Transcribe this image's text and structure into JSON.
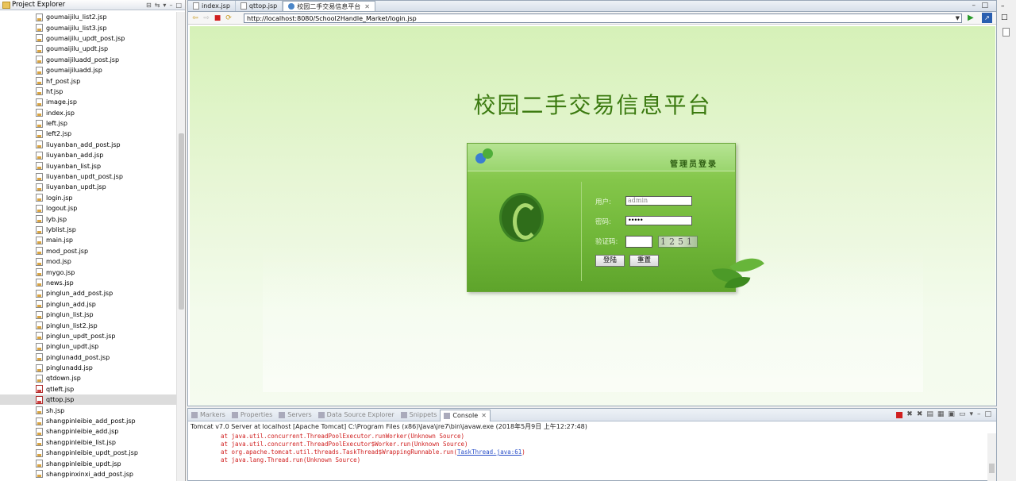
{
  "project_explorer": {
    "title": "Project Explorer",
    "files": [
      {
        "name": "goumaijilu_list2.jsp",
        "type": "jsp"
      },
      {
        "name": "goumaijilu_list3.jsp",
        "type": "jsp"
      },
      {
        "name": "goumaijilu_updt_post.jsp",
        "type": "jsp"
      },
      {
        "name": "goumaijilu_updt.jsp",
        "type": "jsp"
      },
      {
        "name": "goumaijiluadd_post.jsp",
        "type": "jsp"
      },
      {
        "name": "goumaijiluadd.jsp",
        "type": "jsp"
      },
      {
        "name": "hf_post.jsp",
        "type": "jsp"
      },
      {
        "name": "hf.jsp",
        "type": "jsp"
      },
      {
        "name": "image.jsp",
        "type": "jsp"
      },
      {
        "name": "index.jsp",
        "type": "jsp"
      },
      {
        "name": "left.jsp",
        "type": "jsp"
      },
      {
        "name": "left2.jsp",
        "type": "jsp"
      },
      {
        "name": "liuyanban_add_post.jsp",
        "type": "jsp"
      },
      {
        "name": "liuyanban_add.jsp",
        "type": "jsp"
      },
      {
        "name": "liuyanban_list.jsp",
        "type": "jsp"
      },
      {
        "name": "liuyanban_updt_post.jsp",
        "type": "jsp"
      },
      {
        "name": "liuyanban_updt.jsp",
        "type": "jsp"
      },
      {
        "name": "login.jsp",
        "type": "jsp"
      },
      {
        "name": "logout.jsp",
        "type": "jsp"
      },
      {
        "name": "lyb.jsp",
        "type": "jsp"
      },
      {
        "name": "lyblist.jsp",
        "type": "jsp"
      },
      {
        "name": "main.jsp",
        "type": "jsp"
      },
      {
        "name": "mod_post.jsp",
        "type": "jsp"
      },
      {
        "name": "mod.jsp",
        "type": "jsp"
      },
      {
        "name": "mygo.jsp",
        "type": "jsp"
      },
      {
        "name": "news.jsp",
        "type": "jsp"
      },
      {
        "name": "pinglun_add_post.jsp",
        "type": "jsp"
      },
      {
        "name": "pinglun_add.jsp",
        "type": "jsp"
      },
      {
        "name": "pinglun_list.jsp",
        "type": "jsp"
      },
      {
        "name": "pinglun_list2.jsp",
        "type": "jsp"
      },
      {
        "name": "pinglun_updt_post.jsp",
        "type": "jsp"
      },
      {
        "name": "pinglun_updt.jsp",
        "type": "jsp"
      },
      {
        "name": "pinglunadd_post.jsp",
        "type": "jsp"
      },
      {
        "name": "pinglunadd.jsp",
        "type": "jsp"
      },
      {
        "name": "qtdown.jsp",
        "type": "jsp"
      },
      {
        "name": "qtleft.jsp",
        "type": "jsp-error"
      },
      {
        "name": "qttop.jsp",
        "type": "jsp-error",
        "selected": true
      },
      {
        "name": "sh.jsp",
        "type": "jsp"
      },
      {
        "name": "shangpinleibie_add_post.jsp",
        "type": "jsp"
      },
      {
        "name": "shangpinleibie_add.jsp",
        "type": "jsp"
      },
      {
        "name": "shangpinleibie_list.jsp",
        "type": "jsp"
      },
      {
        "name": "shangpinleibie_updt_post.jsp",
        "type": "jsp"
      },
      {
        "name": "shangpinleibie_updt.jsp",
        "type": "jsp"
      },
      {
        "name": "shangpinxinxi_add_post.jsp",
        "type": "jsp"
      }
    ]
  },
  "editor": {
    "tabs": [
      {
        "label": "index.jsp"
      },
      {
        "label": "qttop.jsp"
      },
      {
        "label": "校园二手交易信息平台",
        "active": true
      }
    ],
    "url": "http://localhost:8080/School2Handle_Market/login.jsp"
  },
  "login_page": {
    "title": "校园二手交易信息平台",
    "box_heading": "管理员登录",
    "user_label": "用户:",
    "user_value": "admin",
    "pass_label": "密码:",
    "pass_value": "•••••",
    "captcha_label": "验证码:",
    "captcha_value": "",
    "captcha_image_text": "1251",
    "login_button": "登陆",
    "reset_button": "重置"
  },
  "console": {
    "tabs": [
      "Markers",
      "Properties",
      "Servers",
      "Data Source Explorer",
      "Snippets",
      "Console"
    ],
    "active_tab": "Console",
    "header": "Tomcat v7.0 Server at localhost [Apache Tomcat] C:\\Program Files (x86)\\Java\\jre7\\bin\\javaw.exe (2018年5月9日 上午12:27:48)",
    "lines": [
      {
        "text": "at java.util.concurrent.ThreadPoolExecutor.runWorker(Unknown Source)"
      },
      {
        "text": "at java.util.concurrent.ThreadPoolExecutor$Worker.run(Unknown Source)"
      },
      {
        "text": "at org.apache.tomcat.util.threads.TaskThread$WrappingRunnable.run(",
        "link": "TaskThread.java:61",
        "tail": ")"
      },
      {
        "text": "at java.lang.Thread.run(Unknown Source)"
      }
    ]
  },
  "colors": {
    "title_green": "#3b7a10",
    "error_red": "#d02020",
    "link_blue": "#2a4fc8"
  }
}
